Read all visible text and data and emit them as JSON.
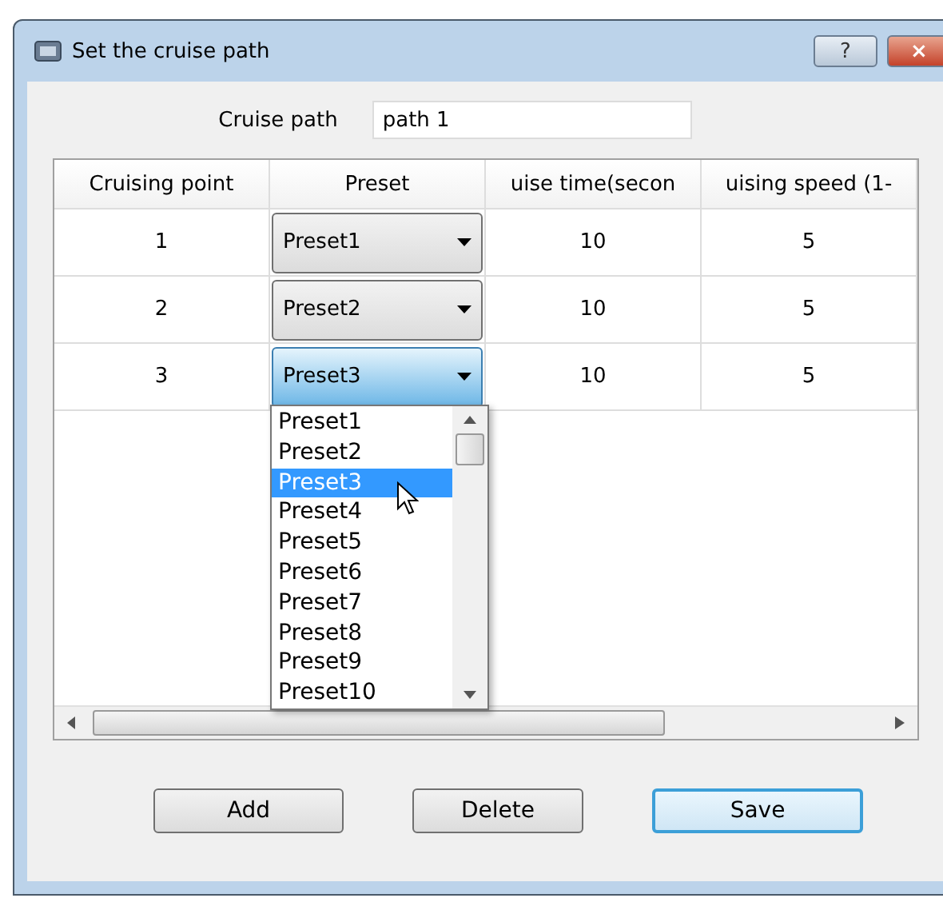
{
  "window": {
    "title": "Set the cruise path",
    "help": "?",
    "close": "×"
  },
  "cruise_path": {
    "label": "Cruise path",
    "value": "path 1"
  },
  "table": {
    "columns": [
      "Cruising point",
      "Preset",
      "uise time(secon",
      "uising speed (1-"
    ],
    "rows": [
      {
        "point": "1",
        "preset": "Preset1",
        "time": "10",
        "speed": "5",
        "open": false
      },
      {
        "point": "2",
        "preset": "Preset2",
        "time": "10",
        "speed": "5",
        "open": false
      },
      {
        "point": "3",
        "preset": "Preset3",
        "time": "10",
        "speed": "5",
        "open": true
      }
    ]
  },
  "dropdown": {
    "items": [
      {
        "label": "Preset1",
        "selected": false
      },
      {
        "label": "Preset2",
        "selected": false
      },
      {
        "label": "Preset3",
        "selected": true
      },
      {
        "label": "Preset4",
        "selected": false
      },
      {
        "label": "Preset5",
        "selected": false
      },
      {
        "label": "Preset6",
        "selected": false
      },
      {
        "label": "Preset7",
        "selected": false
      },
      {
        "label": "Preset8",
        "selected": false
      },
      {
        "label": "Preset9",
        "selected": false
      },
      {
        "label": "Preset10",
        "selected": false
      }
    ]
  },
  "buttons": [
    {
      "label": "Add",
      "default": false
    },
    {
      "label": "Delete",
      "default": false
    },
    {
      "label": "Save",
      "default": true
    }
  ]
}
